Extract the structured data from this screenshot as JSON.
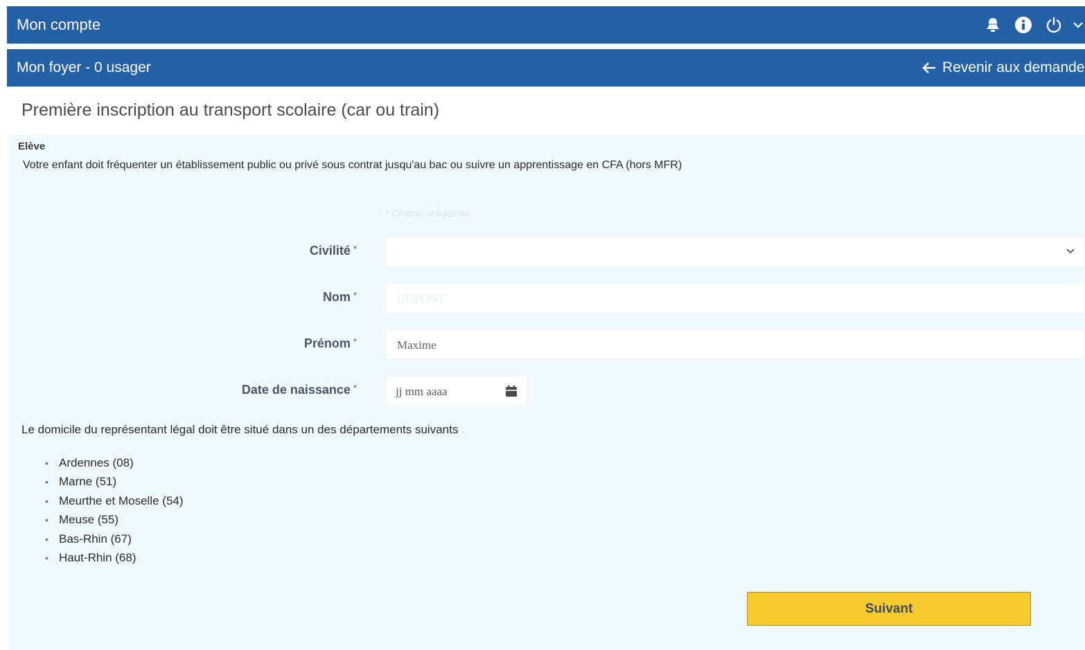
{
  "header": {
    "title": "Mon compte",
    "icons": [
      "bell-icon",
      "info-icon",
      "power-icon",
      "chevron-down-icon"
    ]
  },
  "subheader": {
    "title": "Mon foyer - 0 usager",
    "back_label": "Revenir aux demandes"
  },
  "page": {
    "title": "Première inscription au transport scolaire (car ou train)"
  },
  "section": {
    "label": "Elève",
    "intro": "Votre enfant doit fréquenter un établissement public ou privé sous contrat jusqu'au bac ou suivre un apprentissage en CFA (hors MFR)"
  },
  "form": {
    "required_note": "* Champ obligatoire",
    "civilite": {
      "label": "Civilité",
      "value": ""
    },
    "nom": {
      "label": "Nom",
      "placeholder": "DUPONT"
    },
    "prenom": {
      "label": "Prénom",
      "placeholder": "Maxime"
    },
    "date_naissance": {
      "label": "Date de naissance",
      "placeholder": "jj mm aaaa"
    },
    "required_marker": "*"
  },
  "domicile": {
    "text": "Le domicile du représentant légal doit être situé dans un des départements suivants",
    "colon": ":",
    "departments": [
      "Ardennes (08)",
      "Marne (51)",
      "Meurthe et Moselle (54)",
      "Meuse (55)",
      "Bas-Rhin (67)",
      "Haut-Rhin (68)"
    ]
  },
  "actions": {
    "next_label": "Suivant"
  },
  "colors": {
    "header_bg": "#2360a5",
    "form_bg": "#f0fafd",
    "button_bg": "#f7ca2e"
  }
}
